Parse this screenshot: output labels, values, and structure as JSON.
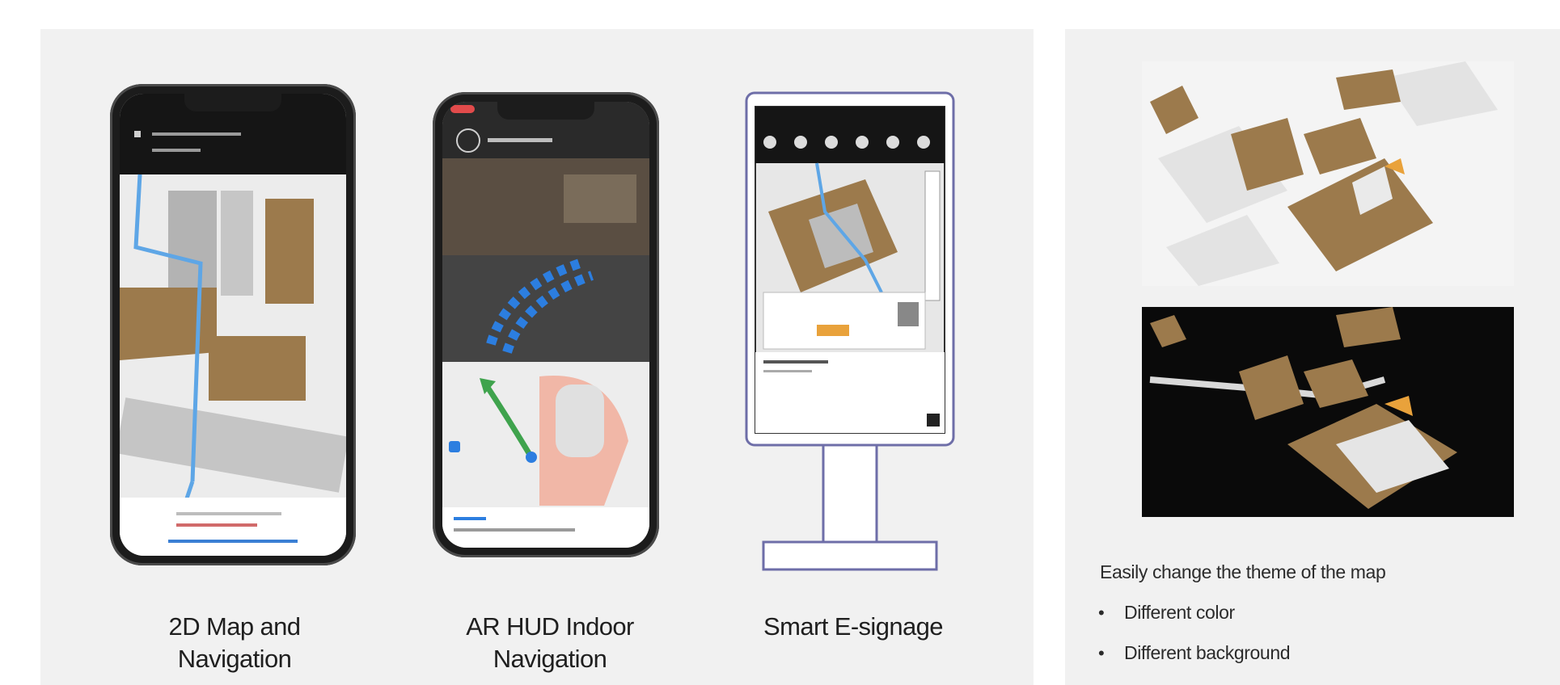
{
  "cards": [
    {
      "caption_line1": "2D Map and",
      "caption_line2": "Navigation"
    },
    {
      "caption_line1": "AR HUD Indoor",
      "caption_line2": "Navigation"
    },
    {
      "caption_line1": "Smart E-signage",
      "caption_line2": ""
    }
  ],
  "theme": {
    "title": "Easily change the theme of the map",
    "bullets": [
      "Different color",
      "Different background"
    ]
  },
  "colors": {
    "panel_bg": "#f1f1f1",
    "map_brown": "#9c7a4c",
    "route_blue": "#5ea6e6",
    "route_green": "#3fa34d",
    "ar_arrow_blue": "#2c7ee0",
    "highlight_orange": "#e9a23b",
    "kiosk_frame": "#6e6ea8"
  }
}
